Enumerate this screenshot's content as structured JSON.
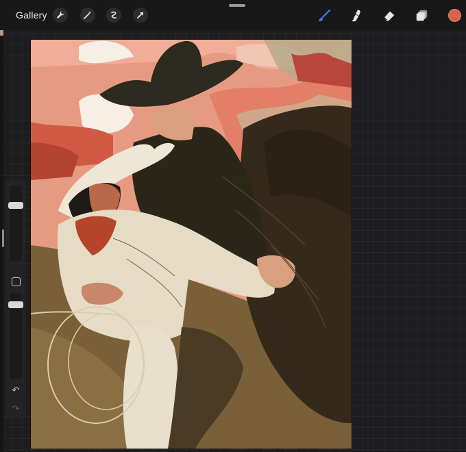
{
  "topbar": {
    "gallery_label": "Gallery",
    "left_tools": [
      "wrench-icon",
      "magic-wand-icon",
      "selection-icon",
      "transform-arrow-icon"
    ],
    "right_tools": [
      "brush-icon",
      "smudge-icon",
      "eraser-icon",
      "layers-icon"
    ],
    "active_tool": "brush",
    "accent_color": "#3b82f6",
    "current_color": "#d9604a"
  },
  "sidebar": {
    "brush_size_level": 0.25,
    "opacity_level": 0.2,
    "undo_icon": "undo-icon",
    "redo_icon": "redo-icon"
  },
  "canvas": {
    "artwork": "painting-wip"
  }
}
